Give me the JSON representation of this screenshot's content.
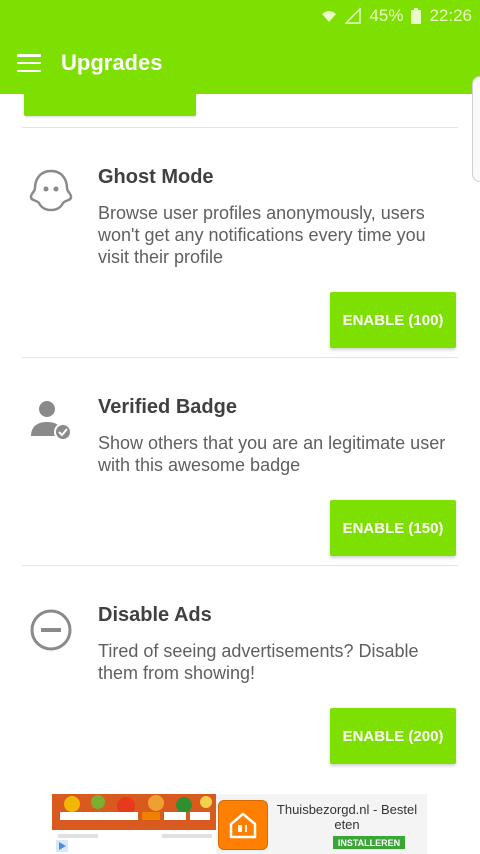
{
  "status_bar": {
    "battery": "45%",
    "time": "22:26"
  },
  "toolbar": {
    "title": "Upgrades"
  },
  "colors": {
    "accent": "#7ee000",
    "text_primary": "#404040",
    "text_secondary": "#5f5f5f"
  },
  "upgrades": [
    {
      "title": "Ghost Mode",
      "description": "Browse user profiles anonymously, users won't get any notifications every time you visit their profile",
      "button": "ENABLE (100)",
      "icon": "ghost-icon"
    },
    {
      "title": "Verified Badge",
      "description": "Show others that you are an legitimate user with this awesome badge",
      "button": "ENABLE (150)",
      "icon": "verified-user-icon"
    },
    {
      "title": "Disable Ads",
      "description": "Tired of seeing advertisements? Disable them from showing!",
      "button": "ENABLE (200)",
      "icon": "minus-circle-icon"
    }
  ],
  "ad": {
    "title": "Thuisbezorgd.nl - Bestel eten",
    "install_label": "INSTALLEREN"
  }
}
